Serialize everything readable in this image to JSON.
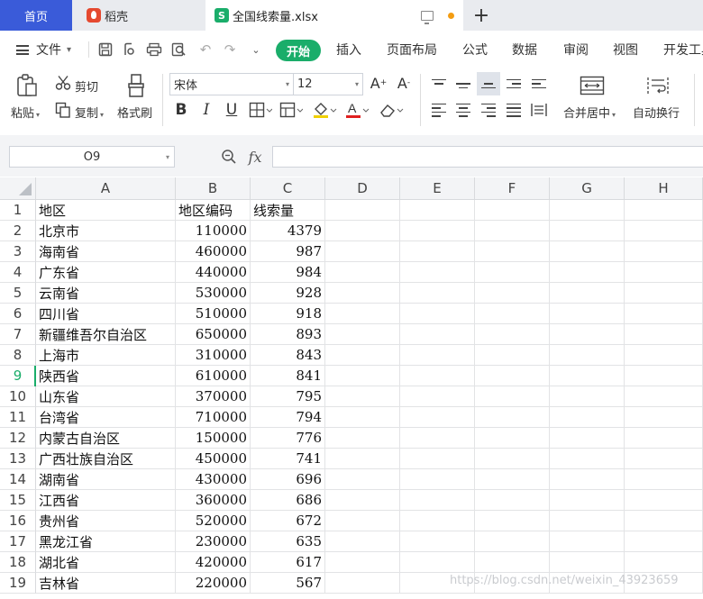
{
  "tabs": {
    "home": "首页",
    "daoke": "稻壳",
    "file": "全国线索量.xlsx",
    "file_icon": "S",
    "add": "+"
  },
  "menu": {
    "file": "文件",
    "start": "开始",
    "items": [
      "插入",
      "页面布局",
      "公式",
      "数据",
      "审阅",
      "视图",
      "开发工具"
    ]
  },
  "ribbon": {
    "paste": "粘贴",
    "cut": "剪切",
    "copy": "复制",
    "format_painter": "格式刷",
    "font_name": "宋体",
    "font_size": "12",
    "bold": "B",
    "italic": "I",
    "underline": "U",
    "merge_center": "合并居中",
    "wrap_text": "自动换行",
    "font_color_accent": "#e02020",
    "fill_color_accent": "#f0d000"
  },
  "formula_bar": {
    "name_box": "O9",
    "fx": "fx",
    "value": ""
  },
  "columns": [
    "A",
    "B",
    "C",
    "D",
    "E",
    "F",
    "G",
    "H"
  ],
  "rows": [
    {
      "n": "1",
      "a": "地区",
      "b": "地区编码",
      "c": "线索量"
    },
    {
      "n": "2",
      "a": "北京市",
      "b": "110000",
      "c": "4379"
    },
    {
      "n": "3",
      "a": "海南省",
      "b": "460000",
      "c": "987"
    },
    {
      "n": "4",
      "a": "广东省",
      "b": "440000",
      "c": "984"
    },
    {
      "n": "5",
      "a": "云南省",
      "b": "530000",
      "c": "928"
    },
    {
      "n": "6",
      "a": "四川省",
      "b": "510000",
      "c": "918"
    },
    {
      "n": "7",
      "a": "新疆维吾尔自治区",
      "b": "650000",
      "c": "893"
    },
    {
      "n": "8",
      "a": "上海市",
      "b": "310000",
      "c": "843"
    },
    {
      "n": "9",
      "a": "陕西省",
      "b": "610000",
      "c": "841"
    },
    {
      "n": "10",
      "a": "山东省",
      "b": "370000",
      "c": "795"
    },
    {
      "n": "11",
      "a": "台湾省",
      "b": "710000",
      "c": "794"
    },
    {
      "n": "12",
      "a": "内蒙古自治区",
      "b": "150000",
      "c": "776"
    },
    {
      "n": "13",
      "a": "广西壮族自治区",
      "b": "450000",
      "c": "741"
    },
    {
      "n": "14",
      "a": "湖南省",
      "b": "430000",
      "c": "696"
    },
    {
      "n": "15",
      "a": "江西省",
      "b": "360000",
      "c": "686"
    },
    {
      "n": "16",
      "a": "贵州省",
      "b": "520000",
      "c": "672"
    },
    {
      "n": "17",
      "a": "黑龙江省",
      "b": "230000",
      "c": "635"
    },
    {
      "n": "18",
      "a": "湖北省",
      "b": "420000",
      "c": "617"
    },
    {
      "n": "19",
      "a": "吉林省",
      "b": "220000",
      "c": "567"
    }
  ],
  "active_row": "9",
  "watermark": "https://blog.csdn.net/weixin_43923659"
}
